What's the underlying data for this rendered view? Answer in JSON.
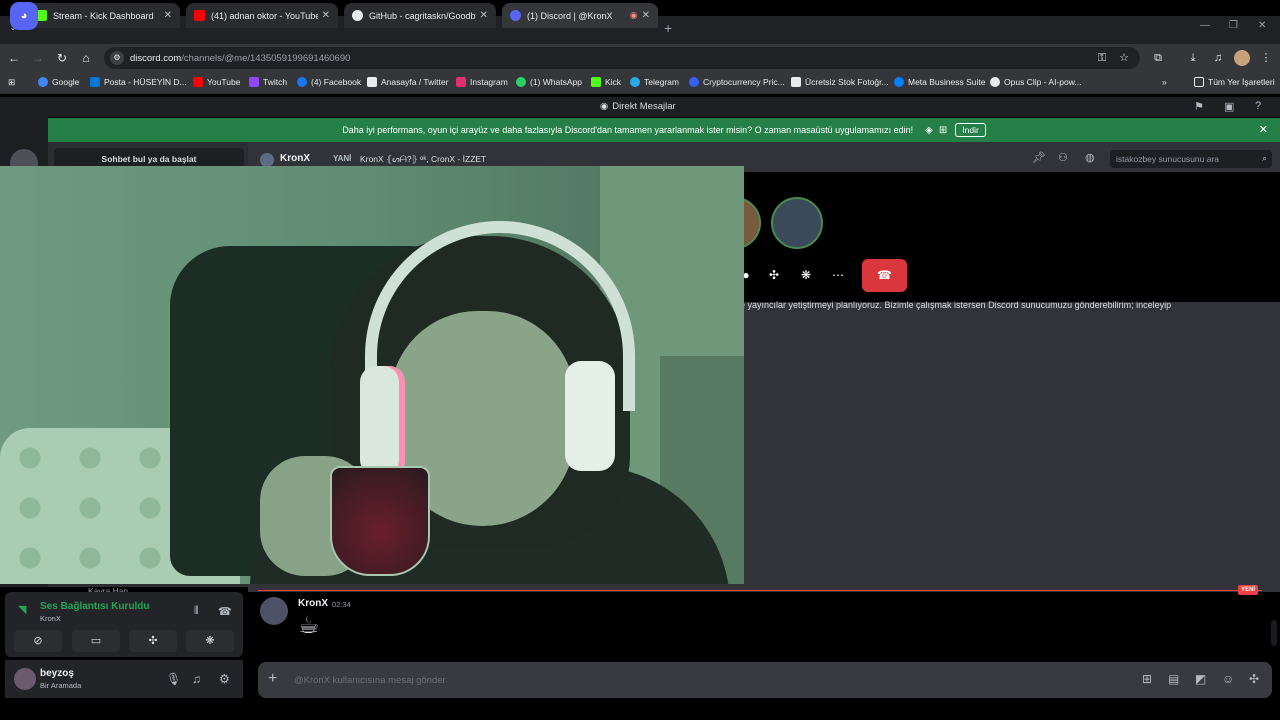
{
  "browser": {
    "tabs": [
      {
        "title": "Stream - Kick Dashboard",
        "favicon_color": "#53fc18",
        "active": false
      },
      {
        "title": "(41) adnan oktor - YouTube",
        "favicon_color": "#ff0000",
        "active": false
      },
      {
        "title": "GitHub - cagritaskn/GoodbyeD",
        "favicon_color": "#e8eaed",
        "active": false
      },
      {
        "title": "(1) Discord | @KronX",
        "favicon_color": "#5865f2",
        "active": true
      }
    ],
    "url_host": "discord.com",
    "url_path": "/channels/@me/1435059199691460690",
    "bookmarks": [
      {
        "label": "Google",
        "color": "#4285f4"
      },
      {
        "label": "Posta - HÜSEYİN D...",
        "color": "#0078d4"
      },
      {
        "label": "YouTube",
        "color": "#ff0000"
      },
      {
        "label": "Twitch",
        "color": "#9146ff"
      },
      {
        "label": "(4) Facebook",
        "color": "#1877f2"
      },
      {
        "label": "Anasayfa / Twitter",
        "color": "#e8eaed"
      },
      {
        "label": "Instagram",
        "color": "#e1306c"
      },
      {
        "label": "(1) WhatsApp",
        "color": "#25d366"
      },
      {
        "label": "Kick",
        "color": "#53fc18"
      },
      {
        "label": "Telegram",
        "color": "#29a9eb"
      },
      {
        "label": "Cryptocurrency Pric...",
        "color": "#3861fb"
      },
      {
        "label": "Ücretsiz Stok Fotoğr...",
        "color": "#e8eaed"
      },
      {
        "label": "Meta Business Suite",
        "color": "#0081fb"
      },
      {
        "label": "Opus Clip - AI-pow...",
        "color": "#e8eaed"
      }
    ],
    "bookmarks_other": "Tüm Yer İşaretleri"
  },
  "discord": {
    "title": "Direkt Mesajlar",
    "banner_text": "Daha iyi performans, oyun içi arayüz ve daha fazlasıyla Discord'dan tamamen yararlanmak ister misin? O zaman masaüstü uygulamamızı edin!",
    "banner_download": "İndir",
    "dm_search": "Sohbet bul ya da başlat",
    "header": {
      "name": "KronX",
      "new_label": "YANİ",
      "group": "KronX ⦃ᔕᗩ?⦄ ᵒᵏ, CronX - İZZET",
      "search_placeholder": "istakozbey sunucusunu ara"
    },
    "message_text": "e yayıncılar yetiştirmeyi planlıyoruz. Bizimle çalışmak istersen Discord sunucumuzu gönderebilirim; inceleyip",
    "new_pill": "YENİ",
    "message": {
      "author": "KronX",
      "time": "02:34",
      "emoji": "☕"
    },
    "composer_placeholder": "@KronX kullanıcısına mesaj gönder",
    "dm_stub": "Kavra Han",
    "voice": {
      "status": "Ses Bağlantısı Kuruldu",
      "channel": "KronX"
    },
    "user": {
      "name": "beyzoş",
      "status": "Bir Aramada"
    }
  }
}
